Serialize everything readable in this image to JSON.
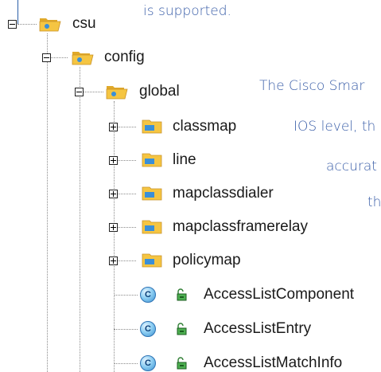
{
  "background_notes": {
    "supported": "is supported.",
    "cisco_smart": "The Cisco Smar",
    "ios_level": "IOS level, th",
    "accurate": "accurat",
    "th": "th"
  },
  "tree": {
    "csu": "csu",
    "config": "config",
    "global": "global",
    "folders": [
      "classmap",
      "line",
      "mapclassdialer",
      "mapclassframerelay",
      "policymap"
    ],
    "classes": [
      "AccessListComponent",
      "AccessListEntry",
      "AccessListMatchInfo"
    ],
    "class_badge": "C"
  },
  "colors": {
    "folder": "#f5c542",
    "class_icon": "#5ab0e6",
    "note_text": "#3a5ea8"
  }
}
